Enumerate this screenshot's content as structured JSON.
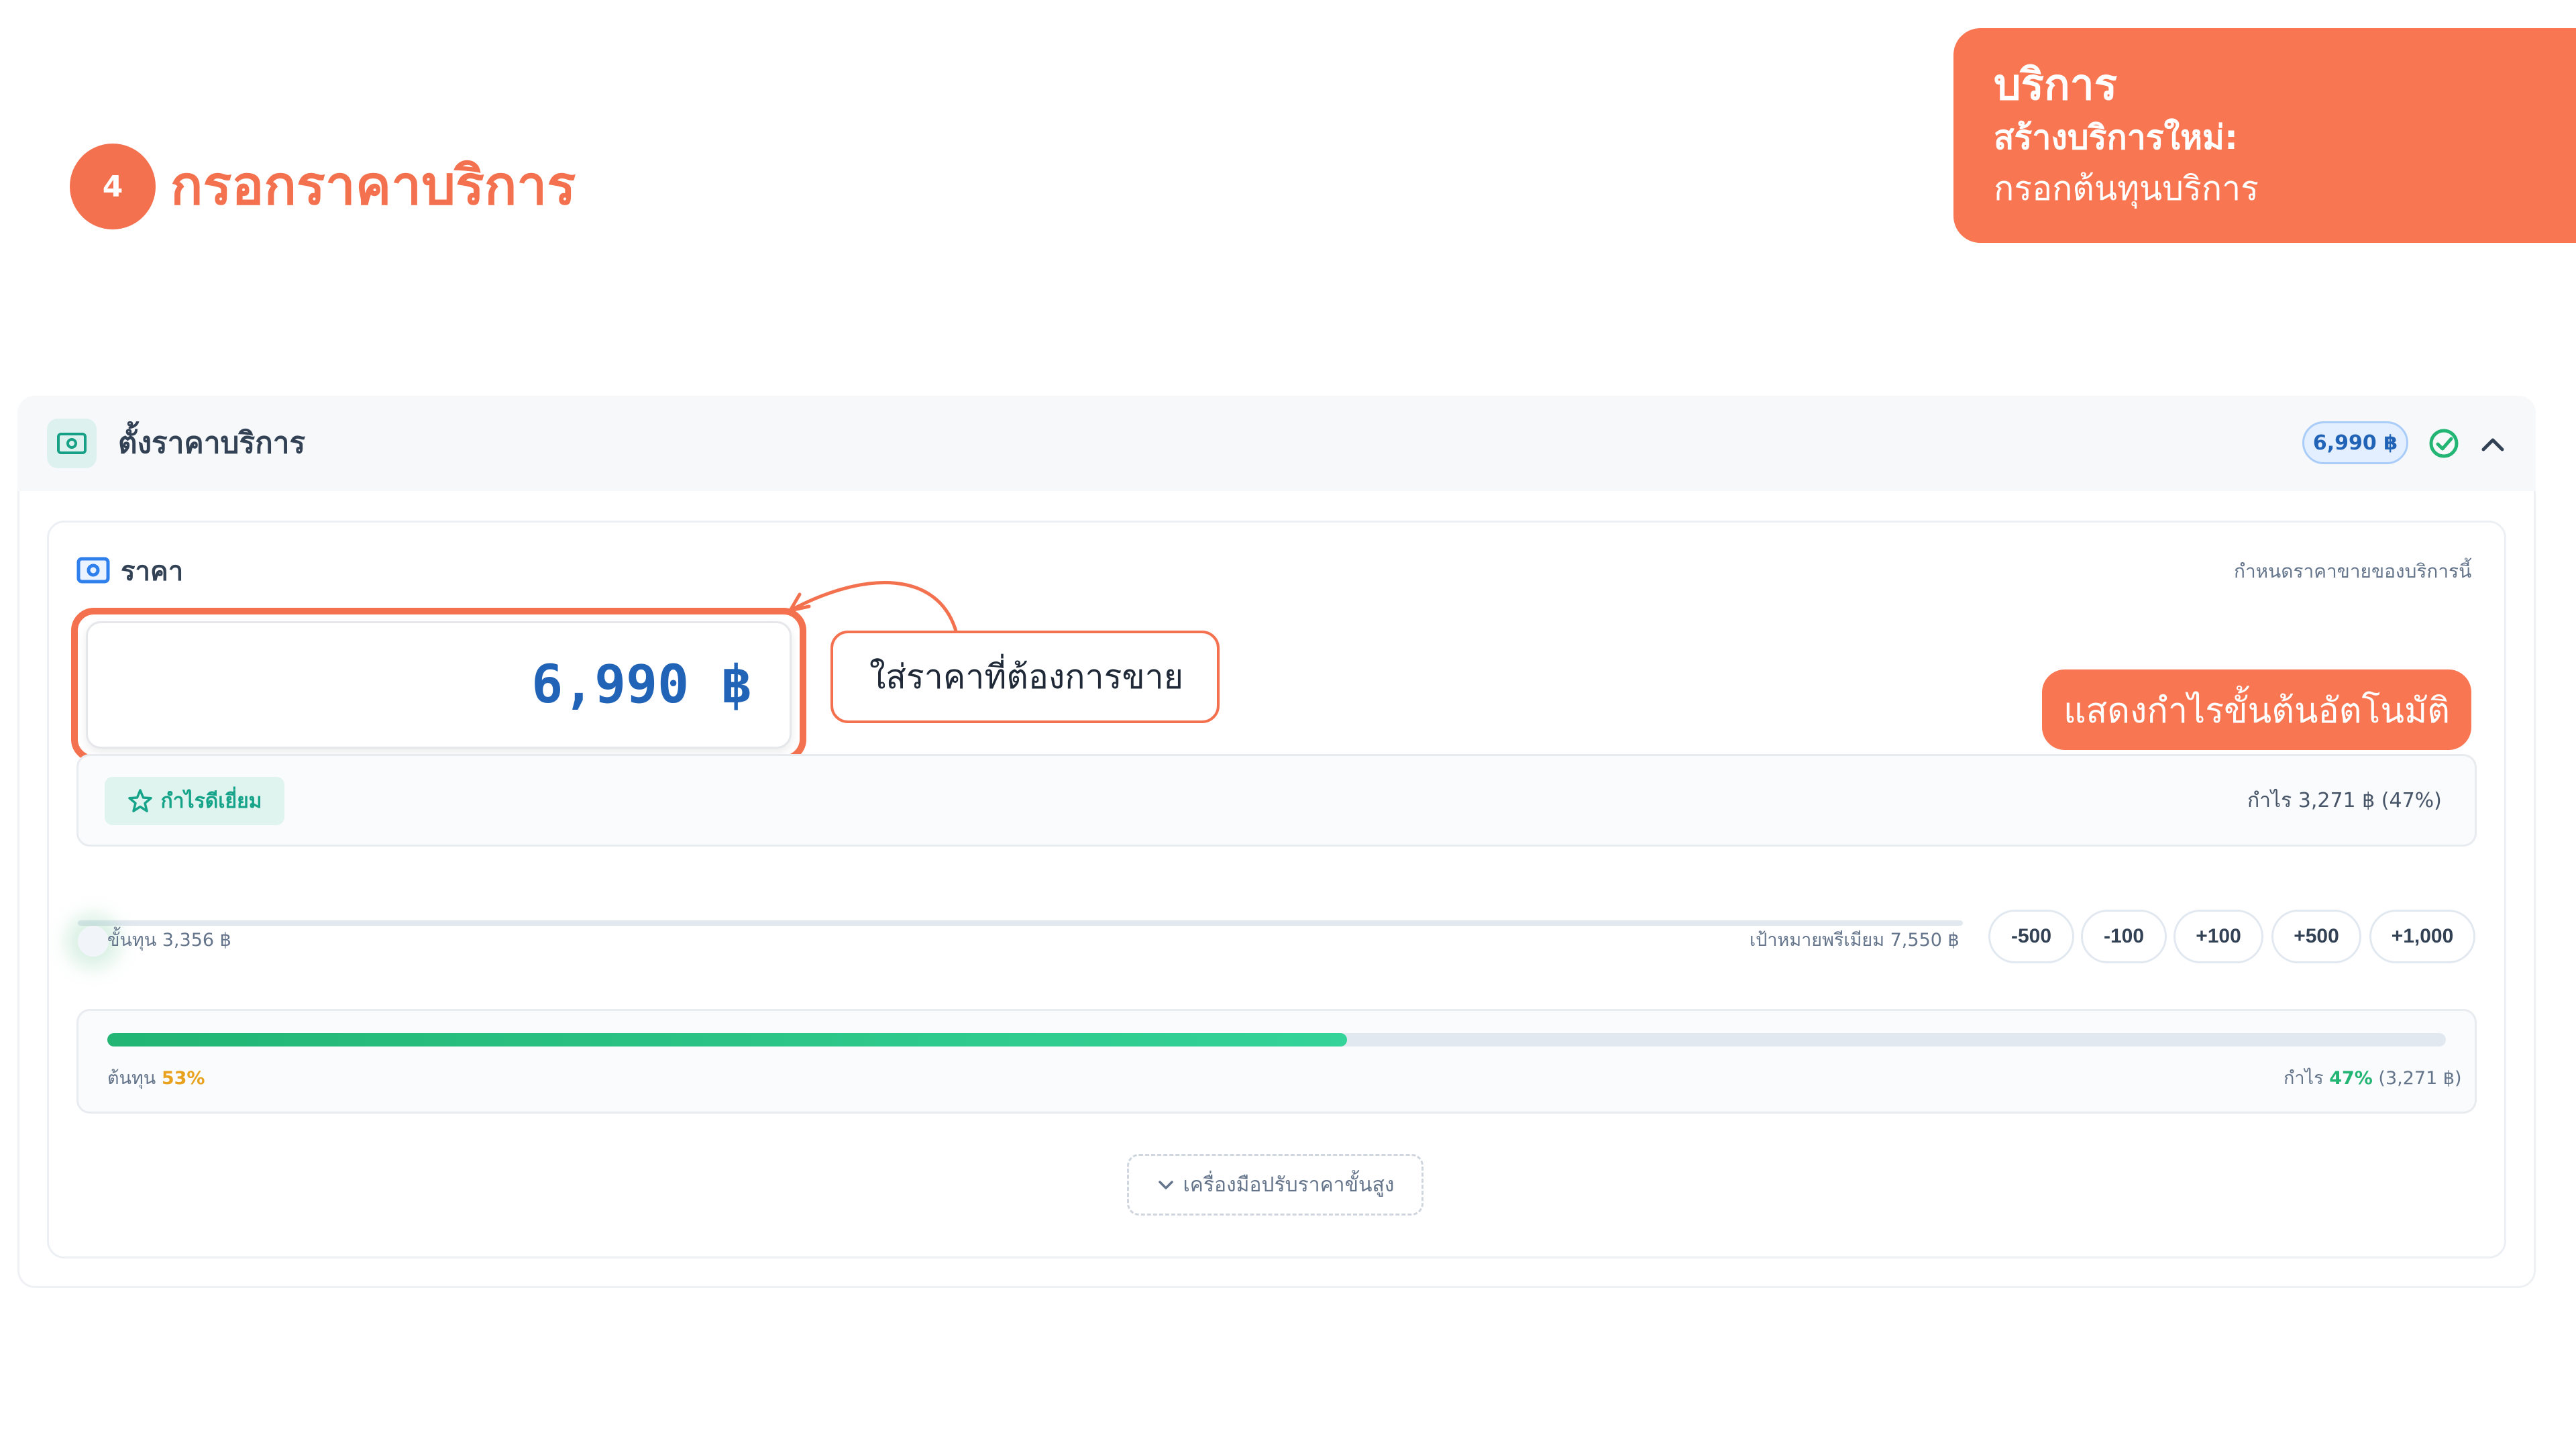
{
  "step": {
    "number": "4",
    "title": "กรอกราคาบริการ"
  },
  "info_card": {
    "title": "บริการ",
    "subtitle": "สร้างบริการใหม่:",
    "description": "กรอกต้นทุนบริการ"
  },
  "section": {
    "title": "ตั้งราคาบริการ",
    "price_pill": "6,990 ฿",
    "icons": {
      "header": "money-icon",
      "done": "check-circle-icon",
      "collapse": "chevron-up-icon"
    }
  },
  "price": {
    "label": "ราคา",
    "hint": "กำหนดราคาขายของบริการนี้",
    "value": "6,990 ฿"
  },
  "callout": {
    "text": "ใส่ราคาที่ต้องการขาย"
  },
  "auto_badge": {
    "text": "แสดงกำไรขั้นต้นอัตโนมัติ"
  },
  "profit": {
    "tag": "กำไรดีเยี่ยม",
    "text": "กำไร 3,271 ฿ (47%)"
  },
  "slider": {
    "min_label": "ขั้นทุน 3,356 ฿",
    "max_label": "เป้าหมายพรีเมียม 7,550 ฿",
    "buttons": [
      "-500",
      "-100",
      "+100",
      "+500",
      "+1,000"
    ]
  },
  "cost_bar": {
    "fill_percent": 53,
    "left_prefix": "ต้นทุน",
    "left_pct": "53%",
    "right_prefix": "กำไร",
    "right_pct": "47%",
    "right_suffix": "(3,271 ฿)"
  },
  "advanced": {
    "label": "เครื่องมือปรับราคาขั้นสูง"
  },
  "colors": {
    "accent": "#f4714f",
    "blue": "#2163b6",
    "green": "#22b573",
    "teal": "#15a389"
  }
}
